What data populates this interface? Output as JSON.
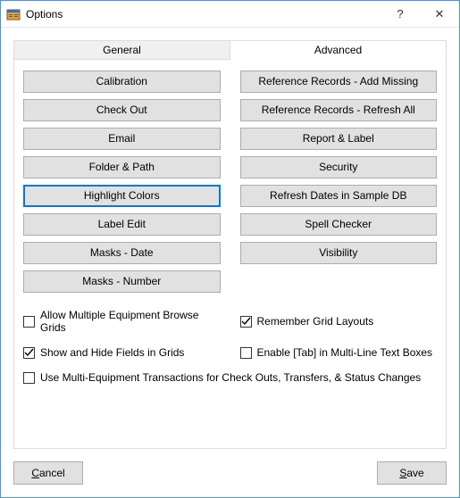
{
  "window": {
    "title": "Options",
    "help_icon": "?",
    "close_icon": "✕"
  },
  "tabs": {
    "general": "General",
    "advanced": "Advanced",
    "active": "advanced"
  },
  "buttons_left": [
    "Calibration",
    "Check Out",
    "Email",
    "Folder & Path",
    "Highlight Colors",
    "Label Edit",
    "Masks - Date",
    "Masks - Number"
  ],
  "buttons_right": [
    "Reference Records - Add Missing",
    "Reference Records - Refresh All",
    "Report & Label",
    "Security",
    "Refresh Dates in Sample DB",
    "Spell Checker",
    "Visibility"
  ],
  "focused_button": "Highlight Colors",
  "checks": {
    "allow_multiple": {
      "label": "Allow Multiple Equipment Browse Grids",
      "checked": false
    },
    "remember_grid": {
      "label": "Remember Grid Layouts",
      "checked": true
    },
    "show_hide": {
      "label": "Show and Hide Fields in Grids",
      "checked": true
    },
    "enable_tab": {
      "label": "Enable [Tab] in Multi-Line Text Boxes",
      "checked": false
    },
    "use_multi_equip": {
      "label": "Use Multi-Equipment Transactions for Check Outs, Transfers, & Status Changes",
      "checked": false
    }
  },
  "footer": {
    "cancel": "Cancel",
    "save": "Save"
  }
}
